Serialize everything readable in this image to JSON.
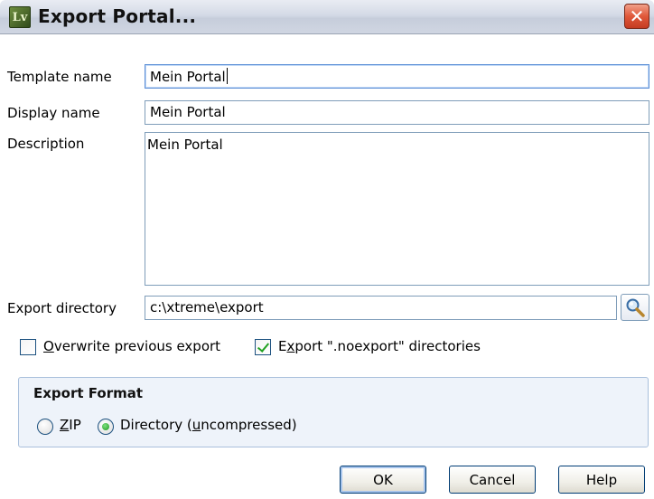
{
  "window": {
    "title": "Export Portal...",
    "app_icon_text": "Lv"
  },
  "form": {
    "template_name_label": "Template name",
    "template_name_value": "Mein Portal",
    "display_name_label": "Display name",
    "display_name_value": "Mein Portal",
    "description_label": "Description",
    "description_value": "Mein Portal",
    "export_directory_label": "Export directory",
    "export_directory_value": "c:\\xtreme\\export"
  },
  "options": {
    "overwrite": {
      "label_mnemonic": "O",
      "label_rest": "verwrite previous export",
      "checked": false
    },
    "export_noexport": {
      "label_pre": "E",
      "label_mnemonic": "x",
      "label_rest": "port \".noexport\" directories",
      "checked": true
    }
  },
  "export_format": {
    "title": "Export Format",
    "zip": {
      "mnemonic": "Z",
      "rest": "IP",
      "selected": false
    },
    "directory": {
      "pre": "Directory (",
      "mnemonic": "u",
      "rest": "ncompressed)",
      "selected": true
    }
  },
  "buttons": {
    "ok": "OK",
    "cancel": "Cancel",
    "help": "Help"
  },
  "icons": {
    "app": "app-icon",
    "close": "close-icon",
    "browse": "magnifier-icon"
  },
  "colors": {
    "field_border": "#7f9db9",
    "group_background": "#eef3fa",
    "check_mark": "#21a121"
  }
}
